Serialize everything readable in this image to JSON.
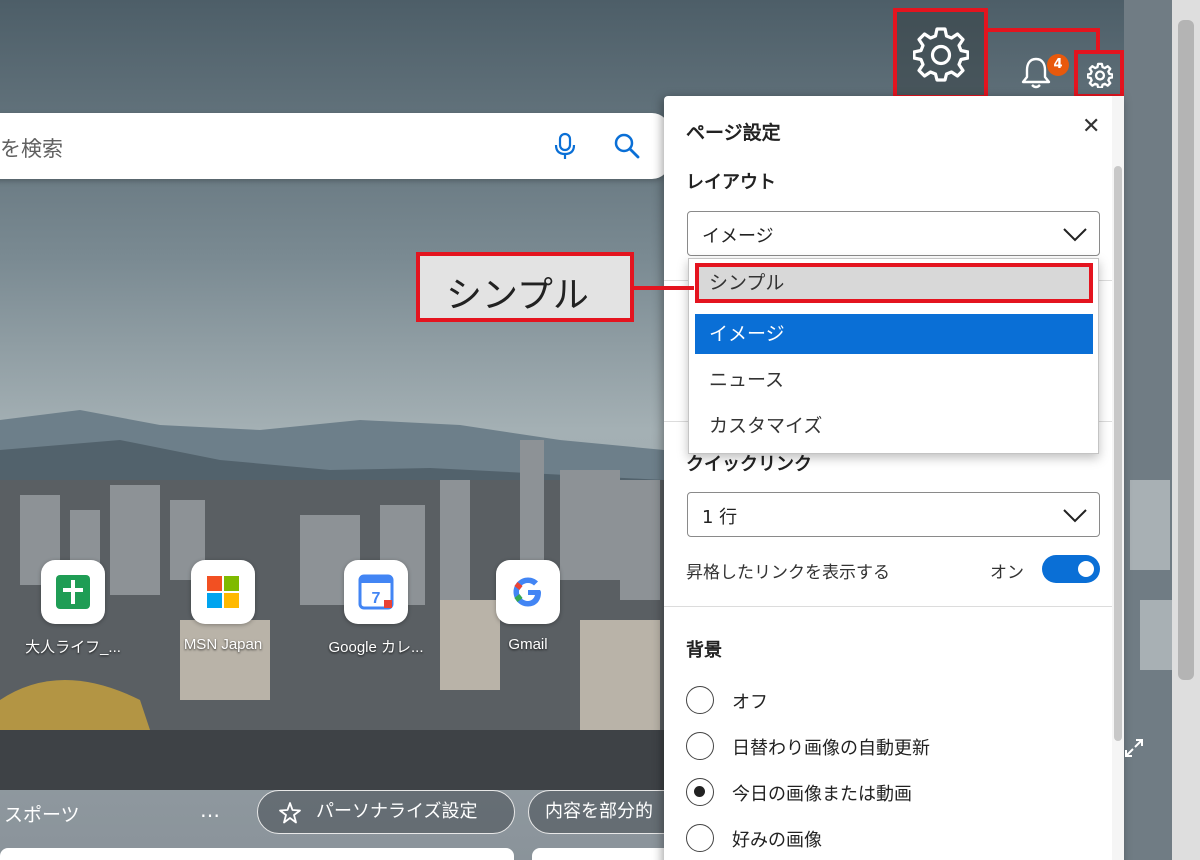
{
  "search": {
    "placeholder_visible": "を検索"
  },
  "top_icons": {
    "notification_count": "4"
  },
  "quick_links": [
    {
      "label": "大人ライフ_...",
      "icon": "green-plus-icon"
    },
    {
      "label": "MSN Japan",
      "icon": "microsoft-logo-icon"
    },
    {
      "label": "Google カレ...",
      "icon": "google-calendar-icon"
    },
    {
      "label": "Gmail",
      "icon": "google-g-icon"
    }
  ],
  "bottom_bar": {
    "sports": "スポーツ",
    "more": "…",
    "personalize": "パーソナライズ設定",
    "partial": "内容を部分的"
  },
  "callout": {
    "text": "シンプル"
  },
  "panel": {
    "title": "ページ設定",
    "close": "✕",
    "layout_label": "レイアウト",
    "layout_value": "イメージ",
    "layout_options": [
      "シンプル",
      "イメージ",
      "ニュース",
      "カスタマイズ"
    ],
    "quick_links_label": "クイックリンク",
    "quick_links_value": "1 行",
    "promoted_links_label": "昇格したリンクを表示する",
    "promoted_links_state": "オン",
    "background_label": "背景",
    "background_options": [
      "オフ",
      "日替わり画像の自動更新",
      "今日の画像または動画",
      "好みの画像"
    ],
    "background_selected_index": 2
  },
  "colors": {
    "accent": "#0a6fd6",
    "highlight_red": "#e4141f",
    "badge": "#e8590c"
  }
}
